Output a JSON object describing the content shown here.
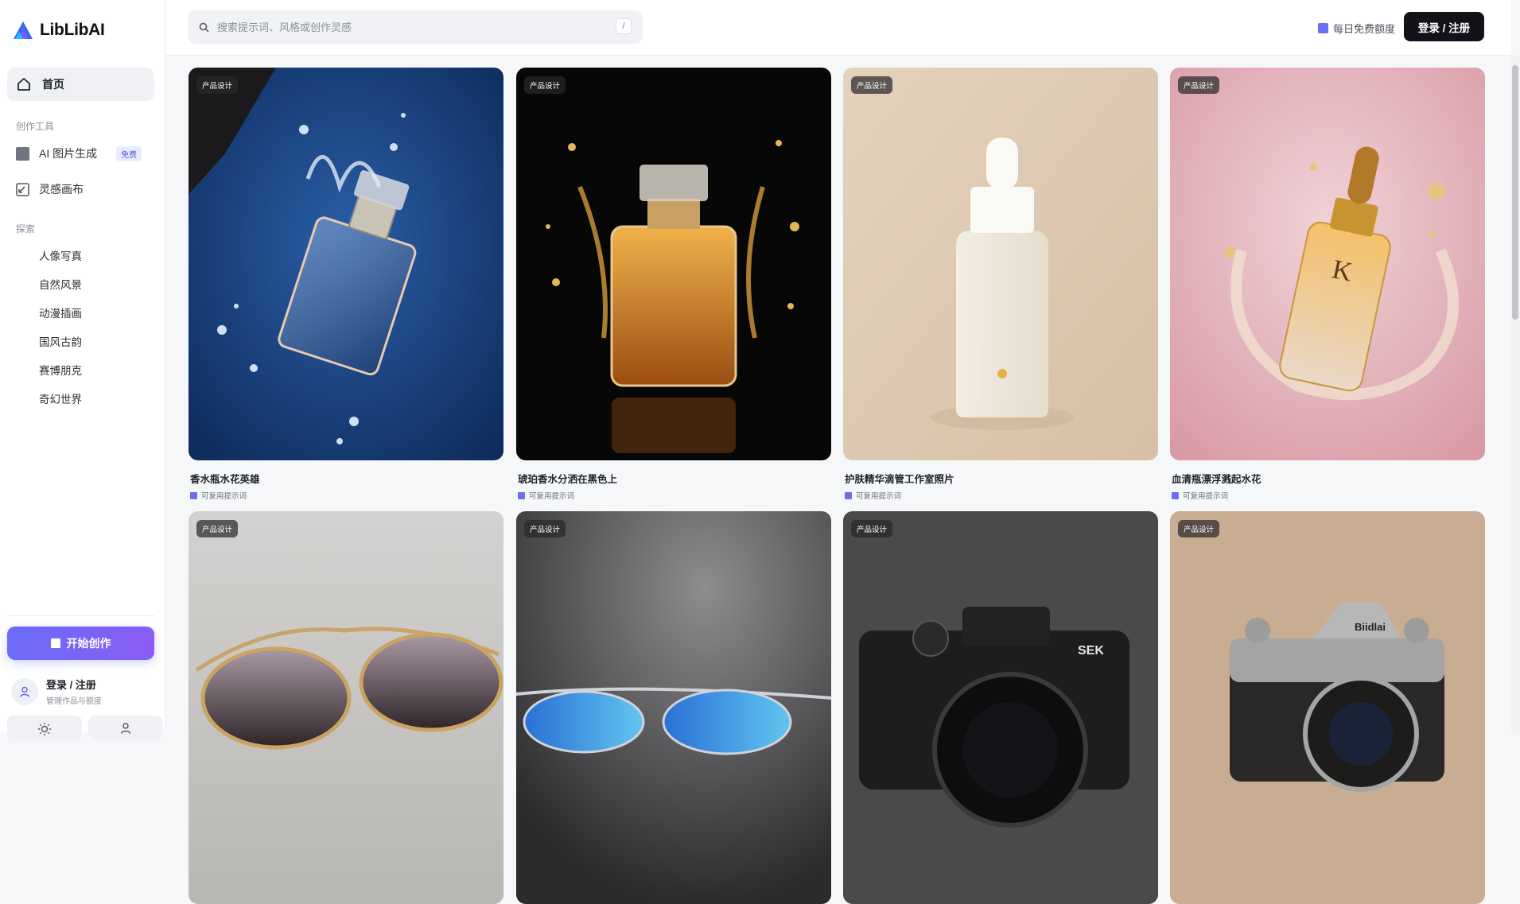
{
  "app": {
    "name": "LibLibAI"
  },
  "sidebar": {
    "home_label": "首页",
    "tools_section": "创作工具",
    "tools": [
      {
        "label": "AI 图片生成",
        "badge": "免费"
      },
      {
        "label": "灵感画布"
      }
    ],
    "explore_section": "探索",
    "explore": [
      "人像写真",
      "自然风景",
      "动漫插画",
      "国风古韵",
      "赛博朋克",
      "奇幻世界"
    ],
    "start_button": "开始创作",
    "login_title": "登录 / 注册",
    "login_sub": "管理作品与额度"
  },
  "header": {
    "search_placeholder": "搜索提示词、风格或创作灵感",
    "search_shortcut": "/",
    "quota_label": "每日免费额度",
    "login_button": "登录 / 注册"
  },
  "cards": [
    {
      "tag": "产品设计",
      "title": "香水瓶水花英雄",
      "sub": "可复用提示词"
    },
    {
      "tag": "产品设计",
      "title": "琥珀香水分洒在黑色上",
      "sub": "可复用提示词"
    },
    {
      "tag": "产品设计",
      "title": "护肤精华滴管工作室照片",
      "sub": "可复用提示词"
    },
    {
      "tag": "产品设计",
      "title": "血清瓶漂浮溅起水花",
      "sub": "可复用提示词"
    },
    {
      "tag": "产品设计"
    },
    {
      "tag": "产品设计"
    },
    {
      "tag": "产品设计",
      "camera_brand": "SEK"
    },
    {
      "tag": "产品设计",
      "camera_brand": "Biidlai"
    }
  ],
  "colors": {
    "accent": "#6b6ff2",
    "dark_button": "#111318"
  }
}
